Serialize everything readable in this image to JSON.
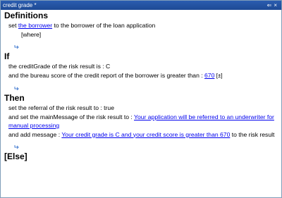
{
  "window": {
    "title": "credit grade *",
    "controls": "←×"
  },
  "definitions": {
    "header": "Definitions",
    "set_prefix": "set",
    "var_name": "the borrower",
    "set_suffix": "to the borrower of the loan application",
    "where": "[where]"
  },
  "if_section": {
    "header": "If",
    "cond1": "the creditGrade of the risk result is : C",
    "cond2_prefix": "and the bureau score of the credit report of the borrower is greater than :",
    "cond2_value": "670",
    "cond2_bracket": "[±]"
  },
  "then_section": {
    "header": "Then",
    "action1": "set the referral of the risk result to : true",
    "action2_prefix": "and set the mainMessage of the risk result to :",
    "action2_link": "Your application will be referred to an underwriter for manual processing",
    "action3_prefix": "and add message :",
    "action3_link": "Your credit grade is C and your credit score is greater than 670",
    "action3_suffix": "to the risk result"
  },
  "else_section": {
    "header": "[Else]"
  }
}
